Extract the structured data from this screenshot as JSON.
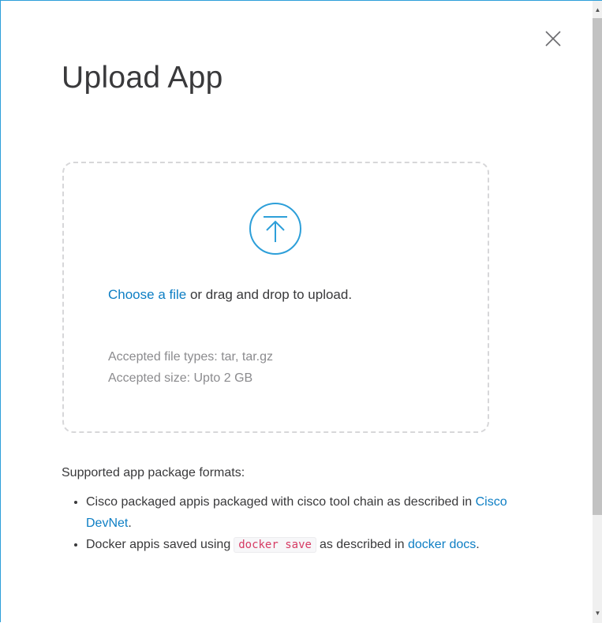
{
  "dialog": {
    "title": "Upload App",
    "close_icon": "close-icon"
  },
  "dropzone": {
    "icon": "upload-arrow-circle-icon",
    "choose_link": "Choose a file",
    "drag_text": " or drag and drop to upload.",
    "accepted_types": "Accepted file types: tar, tar.gz",
    "accepted_size": "Accepted size: Upto 2 GB"
  },
  "formats": {
    "heading": "Supported app package formats:",
    "items": [
      {
        "text_before": "Cisco packaged appis packaged with cisco tool chain as described in ",
        "link": "Cisco DevNet",
        "text_after": "."
      },
      {
        "text_before": "Docker appis saved using",
        "code": "docker save",
        "text_middle": "as described in ",
        "link": "docker docs",
        "text_after": "."
      }
    ]
  },
  "colors": {
    "accent": "#0d7ec4",
    "icon": "#2d9fd9",
    "border": "#2d9fd9",
    "code": "#d63a63"
  }
}
